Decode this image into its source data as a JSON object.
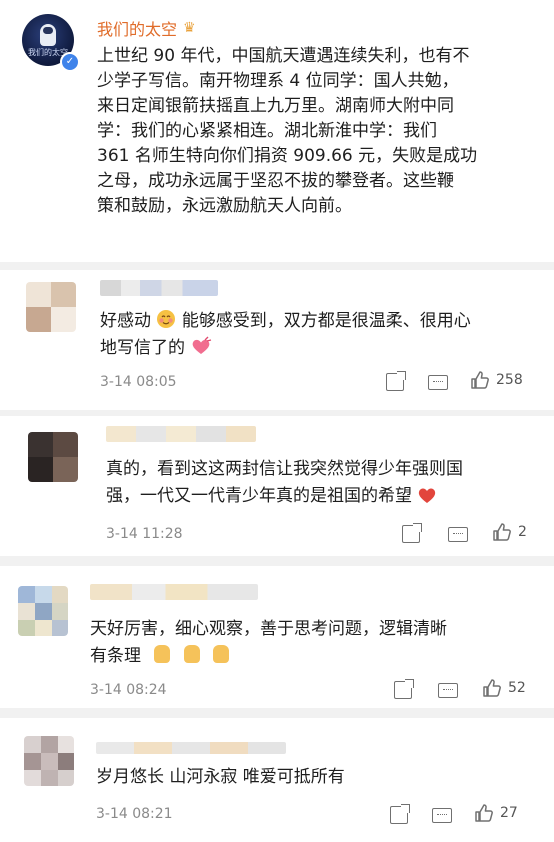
{
  "post": {
    "author": "我们的太空",
    "avatar_text": "我们的太空",
    "body": "上世纪 90 年代，中国航天遭遇连续失利，也有不\n少学子写信。南开物理系 4 位同学：国人共勉，\n来日定闻银箭扶摇直上九万里。湖南师大附中同\n学：我们的心紧紧相连。湖北新淮中学：我们\n361 名师生特向你们捐资 909.66 元，失败是成功\n之母，成功永远属于坚忍不拔的攀登者。这些鞭\n策和鼓励，永远激励航天人向前。"
  },
  "comments": [
    {
      "text_a": "好感动",
      "text_b": "能够感受到，双方都是很温柔、很用心",
      "text_c": "地写信了的",
      "time": "3-14 08:05",
      "likes": "258"
    },
    {
      "text_a": "真的，看到这这两封信让我突然觉得少年强则国",
      "text_b": "强，一代又一代青少年真的是祖国的希望",
      "time": "3-14 11:28",
      "likes": "2"
    },
    {
      "text_a": "天好厉害，细心观察，善于思考问题，逻辑清晰",
      "text_b": "有条理",
      "time": "3-14 08:24",
      "likes": "52"
    },
    {
      "text_a": "岁月悠长 山河永寂 唯爱可抵所有",
      "time": "3-14 08:21",
      "likes": "27"
    }
  ],
  "colors": {
    "author": "#e06c2a",
    "verified": "#3f83ea",
    "heart": "#e2453c"
  },
  "icons": [
    "crown-icon",
    "verified-icon",
    "share-icon",
    "comment-icon",
    "like-icon",
    "blush-emoji-icon",
    "heart-gift-icon",
    "red-heart-icon",
    "thumbs-up-emoji-icon"
  ]
}
